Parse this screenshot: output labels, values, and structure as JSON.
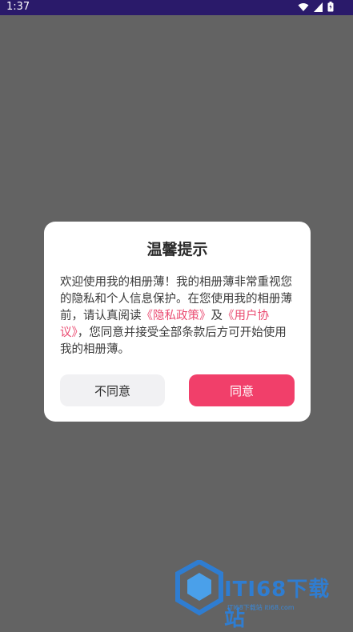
{
  "status_bar": {
    "time": "1:37",
    "icons": [
      "wifi-icon",
      "signal-icon",
      "battery-icon"
    ]
  },
  "dialog": {
    "title": "温馨提示",
    "body": {
      "part1": "欢迎使用我的相册薄！我的相册薄非常重视您的隐私和个人信息保护。在您使用我的相册薄前，请认真阅读",
      "privacy_link": "《隐私政策》",
      "and": "及",
      "terms_link": "《用户协议》",
      "part2": "，您同意并接受全部条款后方可开始使用我的相册薄。"
    },
    "disagree_label": "不同意",
    "agree_label": "同意"
  },
  "watermark": {
    "text": "ITI68下载站",
    "subtext": "ITI68下载站 iti68.com"
  },
  "colors": {
    "status_bar": "#2a1a6a",
    "overlay": "#636363",
    "accent": "#f13f6a",
    "link": "#ea4c72"
  }
}
